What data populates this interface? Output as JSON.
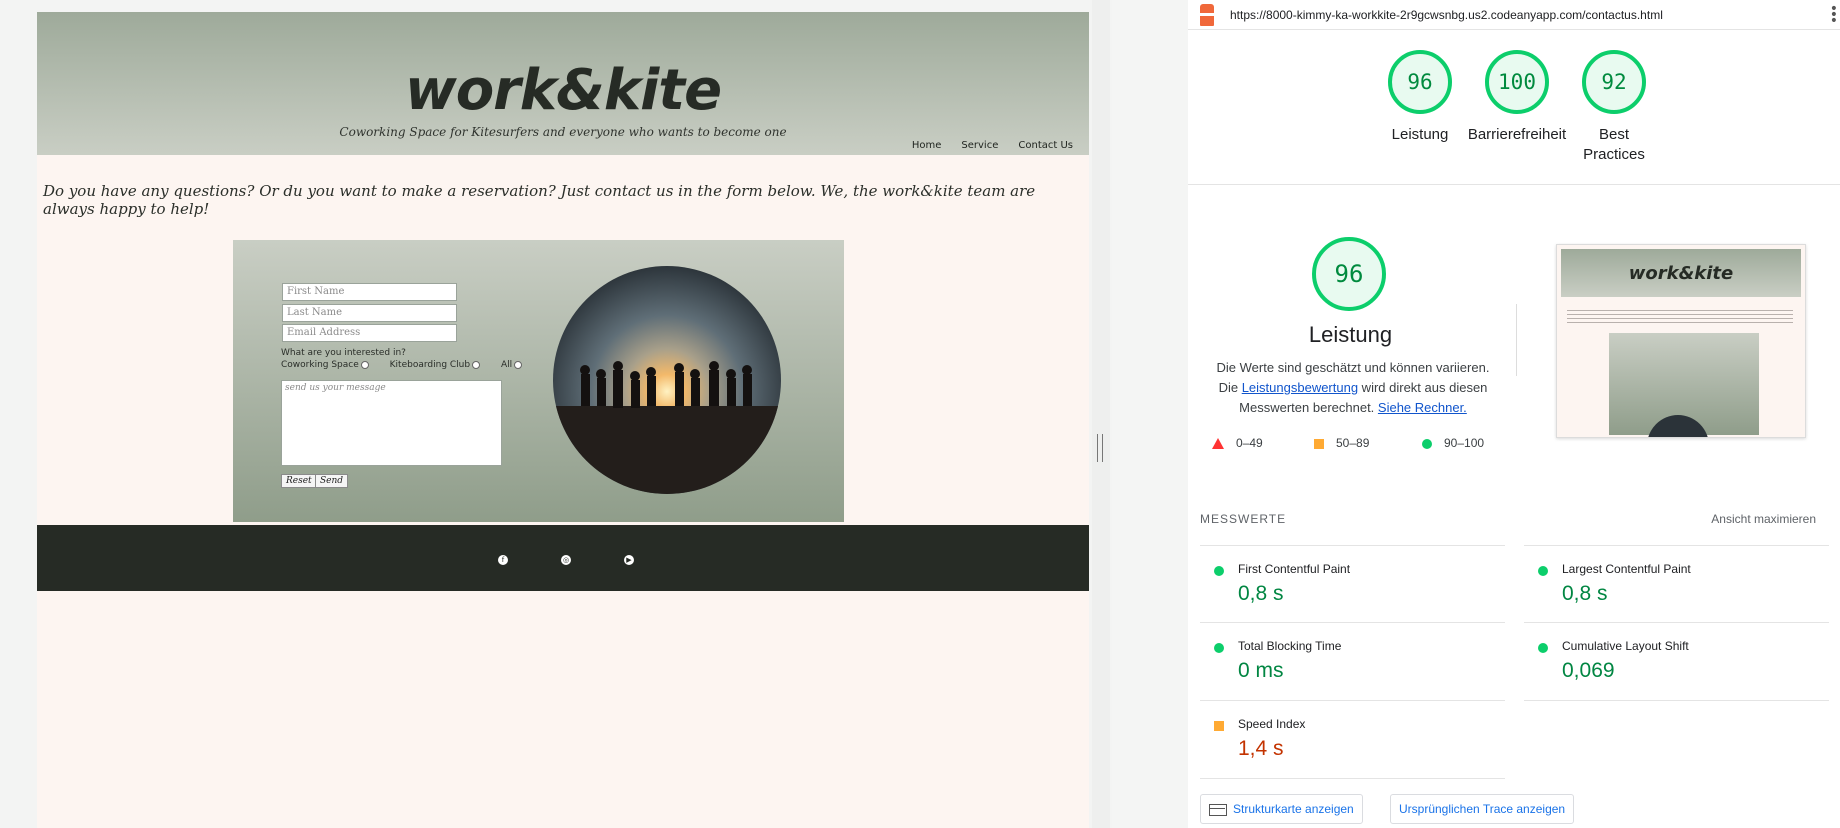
{
  "site": {
    "brand": "work&kite",
    "tagline": "Coworking Space for Kitesurfers and everyone who wants to become one",
    "nav": [
      "Home",
      "Service",
      "Contact Us"
    ],
    "intro": "Do you have any questions? Or du you want to make a reservation? Just contact us in the form below. We, the work&kite team are always happy to help!",
    "form": {
      "first_name_placeholder": "First Name",
      "last_name_placeholder": "Last Name",
      "email_placeholder": "Email Address",
      "question": "What are you interested in?",
      "options": [
        "Coworking Space",
        "Kiteboarding Club",
        "All"
      ],
      "message_placeholder": "send us your message",
      "reset_label": "Reset",
      "send_label": "Send"
    },
    "footer_icons": [
      "facebook-icon",
      "instagram-icon",
      "youtube-icon"
    ]
  },
  "lighthouse": {
    "url": "https://8000-kimmy-ka-workkite-2r9gcwsnbg.us2.codeanyapp.com/contactus.html",
    "scores": [
      {
        "value": "96",
        "label": "Leistung"
      },
      {
        "value": "100",
        "label": "Barrierefreiheit"
      },
      {
        "value": "92",
        "label": "Best Practices"
      }
    ],
    "main": {
      "score": "96",
      "title": "Leistung",
      "desc_part1": "Die Werte sind geschätzt und können variieren. Die ",
      "desc_link1": "Leistungsbewertung",
      "desc_part2": " wird direkt aus diesen Messwerten berechnet. ",
      "desc_link2": "Siehe Rechner."
    },
    "legend": [
      "0–49",
      "50–89",
      "90–100"
    ],
    "metrics_header": "MESSWERTE",
    "expand_label": "Ansicht maximieren",
    "metrics": [
      {
        "name": "First Contentful Paint",
        "value": "0,8 s",
        "status": "good"
      },
      {
        "name": "Largest Contentful Paint",
        "value": "0,8 s",
        "status": "good"
      },
      {
        "name": "Total Blocking Time",
        "value": "0 ms",
        "status": "good"
      },
      {
        "name": "Cumulative Layout Shift",
        "value": "0,069",
        "status": "good"
      },
      {
        "name": "Speed Index",
        "value": "1,4 s",
        "status": "average"
      }
    ],
    "buttons": {
      "treemap": "Strukturkarte anzeigen",
      "trace": "Ursprünglichen Trace anzeigen"
    },
    "colors": {
      "good": "#0cce6b",
      "average": "#ffaa33",
      "fail": "#ff3333"
    }
  }
}
